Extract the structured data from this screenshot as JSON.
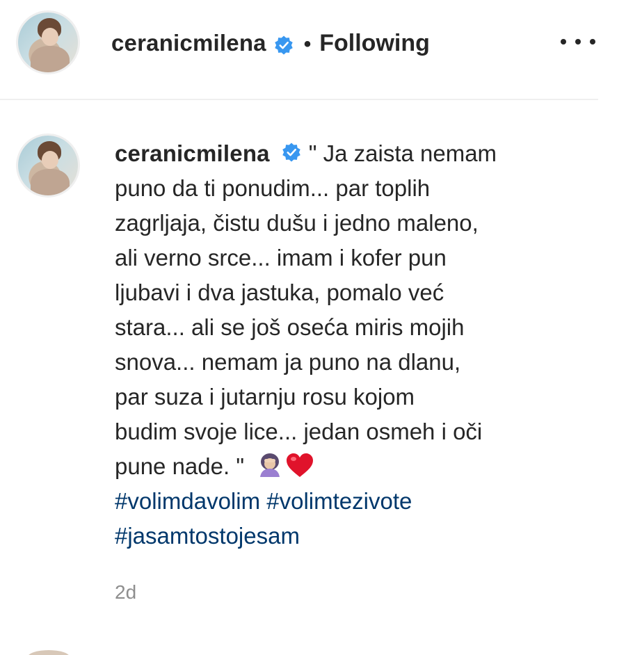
{
  "header": {
    "username": "ceranicmilena",
    "separator": "•",
    "follow_status": "Following",
    "more_label": "..."
  },
  "comment": {
    "username": "ceranicmilena",
    "caption_lines": [
      "\" Ja zaista nemam",
      "puno da ti ponudim... par toplih",
      "zagrljaja, čistu dušu i jedno maleno,",
      "ali verno srce... imam i kofer pun",
      "ljubavi i dva jastuka, pomalo već",
      "stara... ali se još oseća miris mojih",
      "snova... nemam ja puno na dlanu,",
      "par suza i jutarnju rosu kojom",
      "budim svoje lice... jedan osmeh i oči",
      "pune nade. \""
    ],
    "emojis": [
      "woman-facepalming-emoji",
      "red-heart-emoji"
    ],
    "hashtags": [
      "#volimdavolim",
      "#volimtezivote",
      "#jasamtostojesam"
    ],
    "timestamp": "2d"
  },
  "colors": {
    "text": "#262626",
    "hashtag": "#00376b",
    "verified": "#3897f0",
    "muted": "#8e8e8e",
    "divider": "#efefef"
  }
}
